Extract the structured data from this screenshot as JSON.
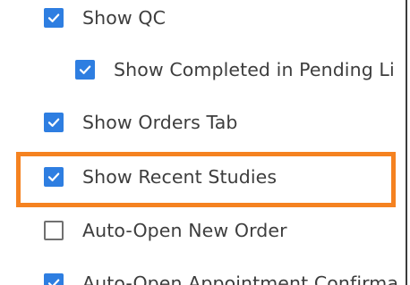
{
  "settings": {
    "items": [
      {
        "label": "Show QC",
        "checked": true
      },
      {
        "label": "Show Completed in Pending Li",
        "checked": true
      },
      {
        "label": "Show Orders Tab",
        "checked": true
      },
      {
        "label": "Show Recent Studies",
        "checked": true
      },
      {
        "label": "Auto-Open New Order",
        "checked": false
      },
      {
        "label": "Auto-Open Appointment Confirma",
        "checked": true
      }
    ]
  },
  "colors": {
    "checkbox_checked": "#2e7ee1",
    "checkbox_unchecked_border": "#707070",
    "highlight": "#f58220",
    "text": "#3d3d3d"
  }
}
